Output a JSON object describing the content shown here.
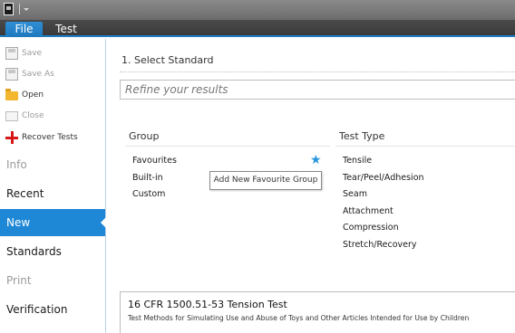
{
  "ribbon": {
    "tabs": [
      {
        "label": "File",
        "active": true
      },
      {
        "label": "Test",
        "active": false
      }
    ]
  },
  "sidebar": {
    "commands": [
      {
        "label": "Save",
        "icon": "save-icon",
        "enabled": false
      },
      {
        "label": "Save As",
        "icon": "save-as-icon",
        "enabled": false
      },
      {
        "label": "Open",
        "icon": "open-folder-icon",
        "enabled": true
      },
      {
        "label": "Close",
        "icon": "close-document-icon",
        "enabled": false
      },
      {
        "label": "Recover Tests",
        "icon": "plus-icon",
        "enabled": true
      }
    ],
    "nav": [
      {
        "label": "Info",
        "enabled": false,
        "active": false
      },
      {
        "label": "Recent",
        "enabled": true,
        "active": false
      },
      {
        "label": "New",
        "enabled": true,
        "active": true
      },
      {
        "label": "Standards",
        "enabled": true,
        "active": false
      },
      {
        "label": "Print",
        "enabled": false,
        "active": false
      },
      {
        "label": "Verification",
        "enabled": true,
        "active": false
      }
    ]
  },
  "main": {
    "section_title": "1. Select Standard",
    "refine_placeholder": "Refine your results",
    "group": {
      "header": "Group",
      "items": [
        "Favourites",
        "Built-in",
        "Custom"
      ],
      "favourite_icon": "star-icon"
    },
    "tooltip": "Add New Favourite Group",
    "test_type": {
      "header": "Test Type",
      "items": [
        "Tensile",
        "Tear/Peel/Adhesion",
        "Seam",
        "Attachment",
        "Compression",
        "Stretch/Recovery"
      ]
    },
    "selected_standard": {
      "title": "16 CFR 1500.51-53 Tension Test",
      "description": "Test Methods for Simulating Use and Abuse of Toys and Other Articles Intended for Use by Children"
    }
  },
  "colors": {
    "accent": "#1f88d6",
    "star": "#2b96dd",
    "recover_plus": "#d61818"
  }
}
